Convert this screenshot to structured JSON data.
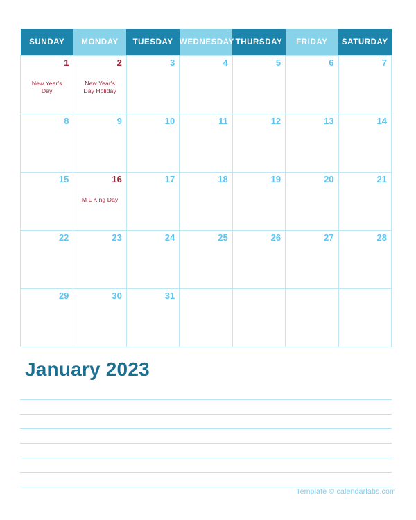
{
  "calendar": {
    "title": "January 2023",
    "weekday_headers": [
      {
        "label": "SUNDAY",
        "style": "dark"
      },
      {
        "label": "MONDAY",
        "style": "light"
      },
      {
        "label": "TUESDAY",
        "style": "dark"
      },
      {
        "label": "WEDNESDAY",
        "style": "light"
      },
      {
        "label": "THURSDAY",
        "style": "dark"
      },
      {
        "label": "FRIDAY",
        "style": "light"
      },
      {
        "label": "SATURDAY",
        "style": "dark"
      }
    ],
    "weeks": [
      [
        {
          "day": "1",
          "holiday": true,
          "events": [
            "New Year's",
            "Day"
          ]
        },
        {
          "day": "2",
          "holiday": true,
          "events": [
            "New Year's",
            "Day Holiday"
          ]
        },
        {
          "day": "3",
          "holiday": false,
          "events": []
        },
        {
          "day": "4",
          "holiday": false,
          "events": []
        },
        {
          "day": "5",
          "holiday": false,
          "events": []
        },
        {
          "day": "6",
          "holiday": false,
          "events": []
        },
        {
          "day": "7",
          "holiday": false,
          "events": []
        }
      ],
      [
        {
          "day": "8",
          "holiday": false,
          "events": []
        },
        {
          "day": "9",
          "holiday": false,
          "events": []
        },
        {
          "day": "10",
          "holiday": false,
          "events": []
        },
        {
          "day": "11",
          "holiday": false,
          "events": []
        },
        {
          "day": "12",
          "holiday": false,
          "events": []
        },
        {
          "day": "13",
          "holiday": false,
          "events": []
        },
        {
          "day": "14",
          "holiday": false,
          "events": []
        }
      ],
      [
        {
          "day": "15",
          "holiday": false,
          "events": []
        },
        {
          "day": "16",
          "holiday": true,
          "events": [
            "M L King Day"
          ]
        },
        {
          "day": "17",
          "holiday": false,
          "events": []
        },
        {
          "day": "18",
          "holiday": false,
          "events": []
        },
        {
          "day": "19",
          "holiday": false,
          "events": []
        },
        {
          "day": "20",
          "holiday": false,
          "events": []
        },
        {
          "day": "21",
          "holiday": false,
          "events": []
        }
      ],
      [
        {
          "day": "22",
          "holiday": false,
          "events": []
        },
        {
          "day": "23",
          "holiday": false,
          "events": []
        },
        {
          "day": "24",
          "holiday": false,
          "events": []
        },
        {
          "day": "25",
          "holiday": false,
          "events": []
        },
        {
          "day": "26",
          "holiday": false,
          "events": []
        },
        {
          "day": "27",
          "holiday": false,
          "events": []
        },
        {
          "day": "28",
          "holiday": false,
          "events": []
        }
      ],
      [
        {
          "day": "29",
          "holiday": false,
          "events": []
        },
        {
          "day": "30",
          "holiday": false,
          "events": []
        },
        {
          "day": "31",
          "holiday": false,
          "events": []
        },
        {
          "day": "",
          "holiday": false,
          "events": []
        },
        {
          "day": "",
          "holiday": false,
          "events": []
        },
        {
          "day": "",
          "holiday": false,
          "events": []
        },
        {
          "day": "",
          "holiday": false,
          "events": []
        }
      ]
    ]
  },
  "notes": {
    "line_count": 7
  },
  "footer": {
    "text": "Template © calendarlabs.com"
  },
  "colors": {
    "header_dark": "#1d84ac",
    "header_light": "#88d2ea",
    "grid_border": "#bfe6f5",
    "day_number": "#5cc6ef",
    "holiday_text": "#a0263a",
    "title": "#1b6f91",
    "note_line": "#b9e4f6",
    "footer_text": "#7ecdef"
  }
}
